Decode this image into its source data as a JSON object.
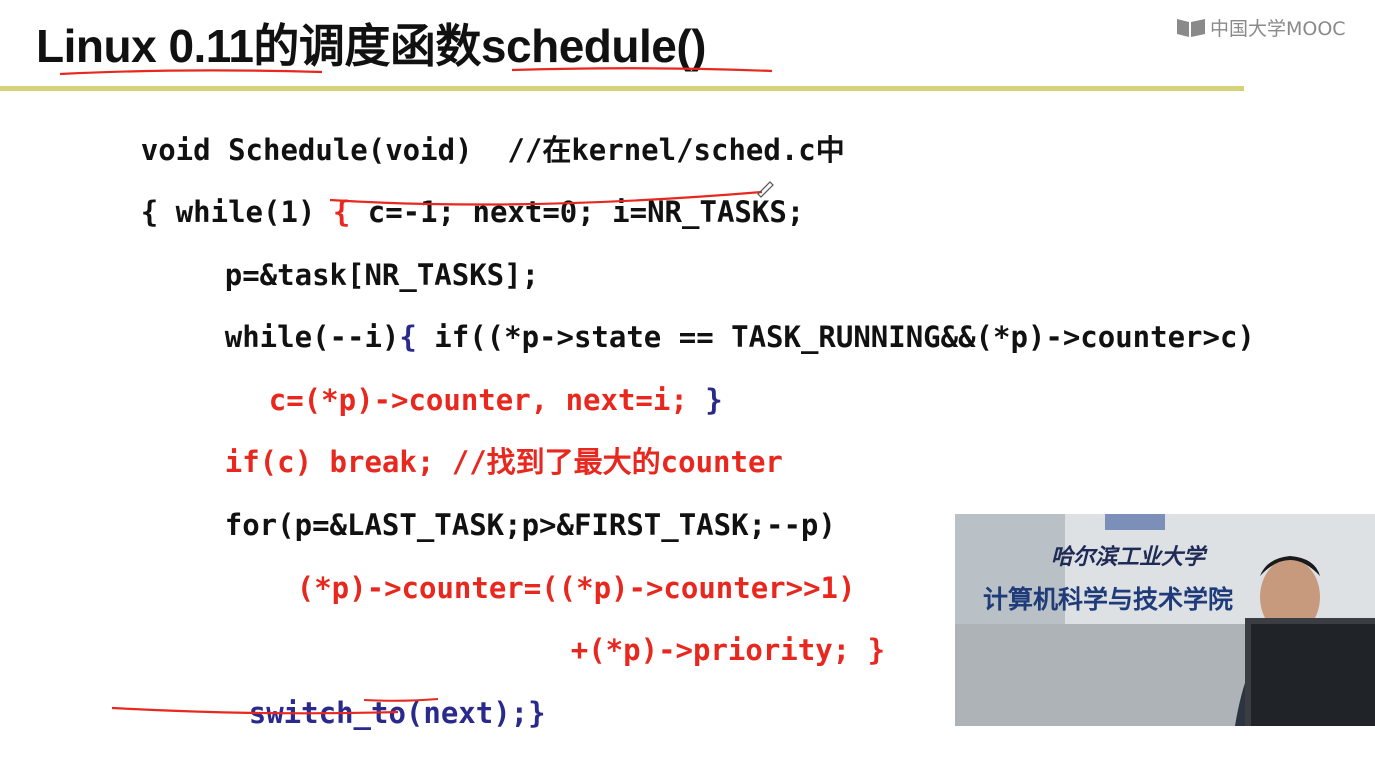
{
  "slide": {
    "title": "Linux 0.11的调度函数schedule()",
    "logo_text": "中国大学MOOC"
  },
  "code": {
    "line1": {
      "text": "void Schedule(void)  //在kernel/sched.c中"
    },
    "line2": {
      "a": "{ while(1) ",
      "b": "{ ",
      "c": "c=-1; next=0; i=NR_TASKS;"
    },
    "line3": {
      "text": "p=&task[NR_TASKS];"
    },
    "line4": {
      "a": "while(--i)",
      "b": "{ ",
      "c": "if((*p->state == TASK_RUNNING&&(*p)->counter>c)"
    },
    "line5": {
      "a": "c=(*p)->counter, next=i; ",
      "b": "}"
    },
    "line6": {
      "text": "if(c) break; //找到了最大的counter"
    },
    "line7": {
      "text": "for(p=&LAST_TASK;p>&FIRST_TASK;--p)"
    },
    "line8": {
      "text": "(*p)->counter=((*p)->counter>>1)"
    },
    "line9": {
      "text": "+(*p)->priority; }"
    },
    "line10": {
      "text": "switch_to(next);}"
    }
  },
  "video": {
    "sign_top": "哈尔滨工业大学",
    "sign_bottom": "计算机科学与技术学院"
  },
  "colors": {
    "black_code": "#111111",
    "red_code": "#e8281e",
    "blue_code": "#2a2a8c",
    "title_rule": "#d6d27a",
    "annotation": "#e8281e"
  }
}
